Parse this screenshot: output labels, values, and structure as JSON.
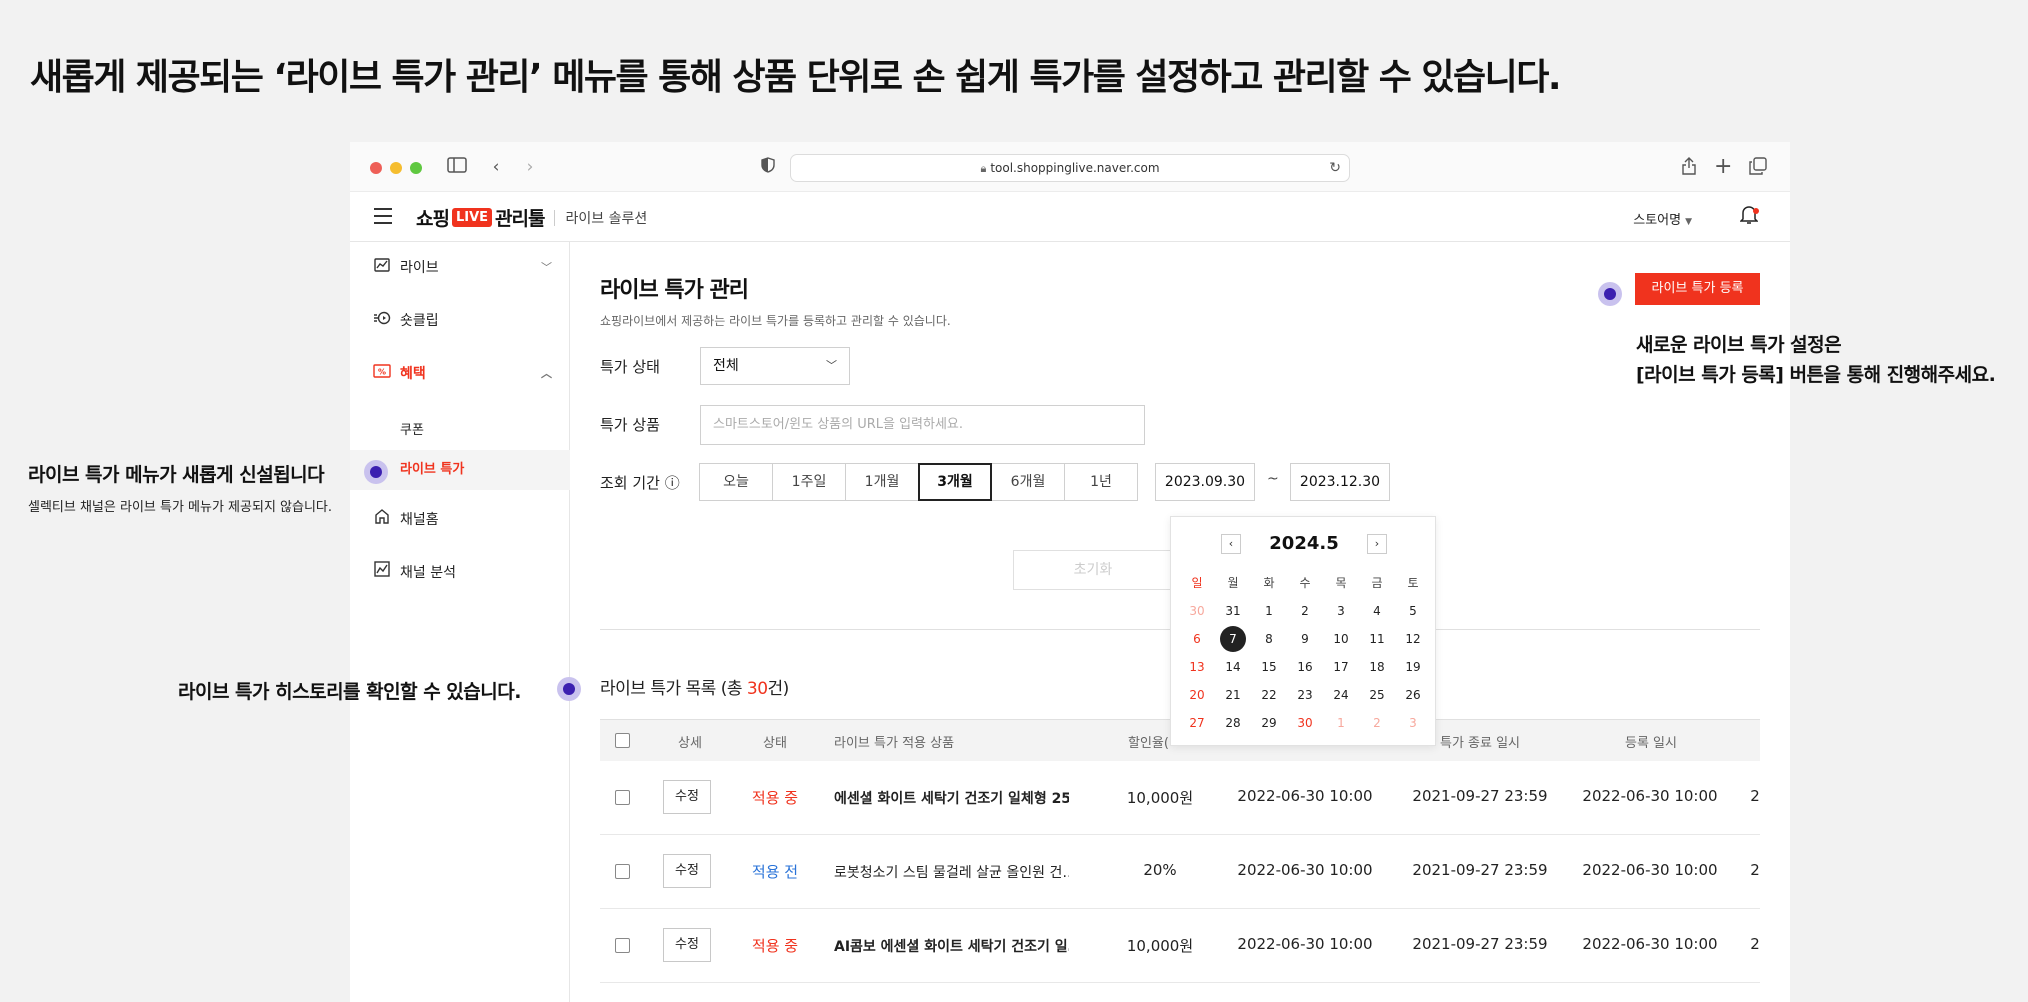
{
  "headline": "새롭게 제공되는 ‘라이브 특가 관리’ 메뉴를 통해 상품 단위로 손 쉽게 특가를 설정하고 관리할 수 있습니다.",
  "browser": {
    "url": "tool.shoppinglive.naver.com",
    "traffic_light_colors": [
      "#ee5f57",
      "#f5bd2f",
      "#5fc840"
    ]
  },
  "header": {
    "logo_text_1": "쇼핑",
    "logo_badge": "LIVE",
    "logo_text_2": "관리툴",
    "logo_sub": "라이브 솔루션",
    "store_name": "스토어명"
  },
  "sidebar": {
    "items": [
      {
        "label": "라이브"
      },
      {
        "label": "숏클립"
      },
      {
        "label": "혜택"
      },
      {
        "label": "쿠폰"
      },
      {
        "label": "라이브 특가"
      },
      {
        "label": "채널홈"
      },
      {
        "label": "채널 분석"
      }
    ]
  },
  "page": {
    "title": "라이브 특가 관리",
    "description": "쇼핑라이브에서 제공하는 라이브 특가를 등록하고 관리할 수 있습니다.",
    "register_button": "라이브 특가 등록",
    "status_label": "특가 상태",
    "status_value": "전체",
    "product_label": "특가 상품",
    "product_placeholder": "스마트스토어/윈도 상품의 URL을 입력하세요.",
    "period_label": "조회 기간 ⓘ",
    "periods": [
      "오늘",
      "1주일",
      "1개월",
      "3개월",
      "6개월",
      "1년"
    ],
    "selected_period": "3개월",
    "date_from": "2023.09.30",
    "date_to": "2023.12.30",
    "tilde": "~",
    "reset_button": "초기화",
    "list_title_prefix": "라이브 특가 목록 (총 ",
    "list_count": "30",
    "list_title_suffix": "건)"
  },
  "calendar": {
    "month": "2024.5",
    "weekdays": [
      "일",
      "월",
      "화",
      "수",
      "목",
      "금",
      "토"
    ],
    "days": [
      "30",
      "31",
      "1",
      "2",
      "3",
      "4",
      "5",
      "6",
      "7",
      "8",
      "9",
      "10",
      "11",
      "12",
      "13",
      "14",
      "15",
      "16",
      "17",
      "18",
      "19",
      "20",
      "21",
      "22",
      "23",
      "24",
      "25",
      "26",
      "27",
      "28",
      "29",
      "30",
      "1",
      "2",
      "3"
    ],
    "selected_day": "7"
  },
  "table": {
    "headers": [
      "상세",
      "상태",
      "라이브 특가 적용 상품",
      "할인율(",
      "특가 종료 일시",
      "등록 일시"
    ],
    "rows": [
      {
        "edit": "수정",
        "status": "적용 중",
        "product": "에센셜 화이트 세탁기 건조기 일체형 25…",
        "discount": "10,000원",
        "start": "2022-06-30 10:00",
        "end": "2021-09-27 23:59",
        "registered": "2022-06-30 10:00",
        "more": "2"
      },
      {
        "edit": "수정",
        "status": "적용 전",
        "product": "로봇청소기 스팀 물걸레 살균 올인원 건…",
        "discount": "20%",
        "start": "2022-06-30 10:00",
        "end": "2021-09-27 23:59",
        "registered": "2022-06-30 10:00",
        "more": "2"
      },
      {
        "edit": "수정",
        "status": "적용 중",
        "product": "AI콤보 에센셜 화이트 세탁기 건조기 일…",
        "discount": "10,000원",
        "start": "2022-06-30 10:00",
        "end": "2021-09-27 23:59",
        "registered": "2022-06-30 10:00",
        "more": "2"
      }
    ]
  },
  "annotations": {
    "register_note_line1": "새로운 라이브 특가 설정은",
    "register_note_line2": "[라이브 특가 등록] 버튼을 통해 진행해주세요.",
    "menu_note_title": "라이브 특가 메뉴가 새롭게 신설됩니다",
    "menu_note_sub": "셀렉티브 채널은 라이브 특가 메뉴가 제공되지 않습니다.",
    "history_note": "라이브 특가 히스토리를 확인할 수 있습니다."
  },
  "colors": {
    "accent": "#f0331e",
    "status_before": "#2a73d8",
    "marker": "#3b1fb0"
  }
}
